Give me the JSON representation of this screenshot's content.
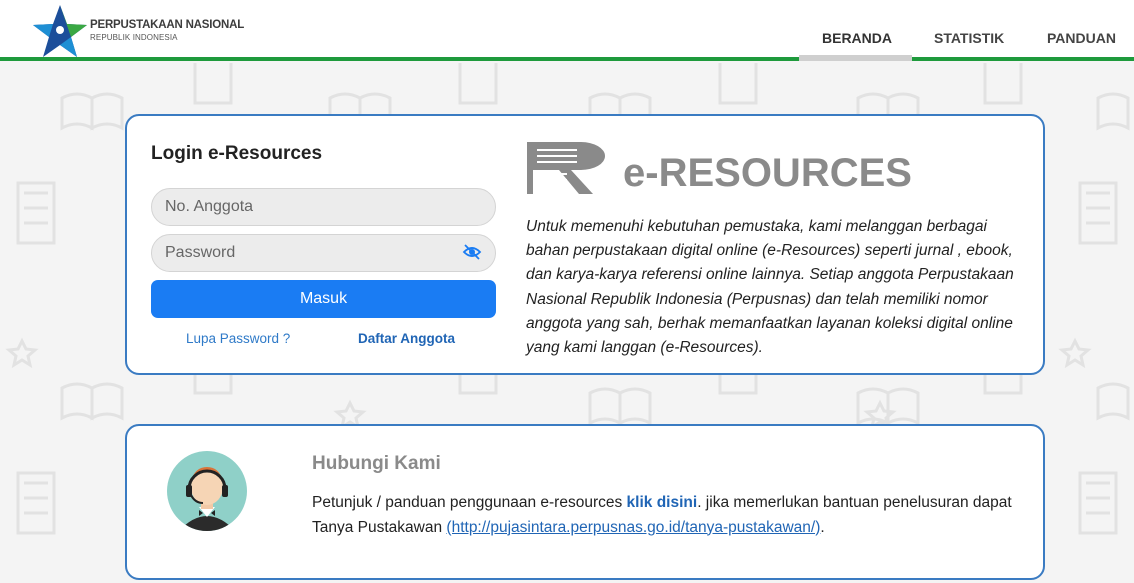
{
  "header": {
    "org_name": "PERPUSTAKAAN NASIONAL",
    "org_subtitle": "REPUBLIK INDONESIA",
    "logo_icon": "star-logo-icon",
    "nav": [
      {
        "label": "BERANDA",
        "active": true
      },
      {
        "label": "STATISTIK",
        "active": false
      },
      {
        "label": "PANDUAN",
        "active": false
      }
    ],
    "accent_color": "#1e9a3c"
  },
  "login": {
    "title": "Login e-Resources",
    "member_placeholder": "No. Anggota",
    "password_placeholder": "Password",
    "password_toggle_icon": "eye-slash-icon",
    "submit_label": "Masuk",
    "forgot_label": "Lupa Password ?",
    "register_label": "Daftar Anggota",
    "button_color": "#1a7cf3"
  },
  "eresources": {
    "brand_text": "e-RESOURCES",
    "description": "Untuk memenuhi kebutuhan pemustaka, kami melanggan berbagai bahan perpustakaan digital online (e-Resources) seperti jurnal , ebook, dan karya-karya referensi online lainnya. Setiap anggota Perpustakaan Nasional Republik Indonesia (Perpusnas) dan telah memiliki nomor anggota yang sah, berhak memanfaatkan layanan koleksi digital online yang kami langgan (e-Resources)."
  },
  "contact": {
    "title": "Hubungi Kami",
    "avatar_icon": "support-agent-icon",
    "text_before": "Petunjuk / panduan penggunaan e-resources ",
    "link_label": "klik disini",
    "text_after": ". jika memerlukan bantuan penelusuran dapat Tanya Pustakawan ",
    "tanya_link": "(http://pujasintara.perpusnas.go.id/tanya-pustakawan/)",
    "text_end": "."
  },
  "card_border_color": "#3a7bc2"
}
